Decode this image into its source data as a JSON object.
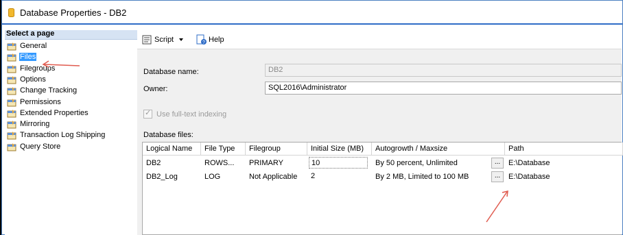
{
  "window": {
    "title": "Database Properties - DB2"
  },
  "sidebar": {
    "header": "Select a page",
    "items": [
      {
        "label": "General",
        "selected": false
      },
      {
        "label": "Files",
        "selected": true
      },
      {
        "label": "Filegroups",
        "selected": false
      },
      {
        "label": "Options",
        "selected": false
      },
      {
        "label": "Change Tracking",
        "selected": false
      },
      {
        "label": "Permissions",
        "selected": false
      },
      {
        "label": "Extended Properties",
        "selected": false
      },
      {
        "label": "Mirroring",
        "selected": false
      },
      {
        "label": "Transaction Log Shipping",
        "selected": false
      },
      {
        "label": "Query Store",
        "selected": false
      }
    ]
  },
  "toolbar": {
    "script_label": "Script",
    "help_label": "Help"
  },
  "form": {
    "database_name_label": "Database name:",
    "database_name_value": "DB2",
    "owner_label": "Owner:",
    "owner_value": "SQL2016\\Administrator",
    "fulltext_label": "Use full-text indexing",
    "fulltext_checked": true,
    "files_label": "Database files:"
  },
  "grid": {
    "columns": [
      "Logical Name",
      "File Type",
      "Filegroup",
      "Initial Size (MB)",
      "Autogrowth / Maxsize",
      "",
      "Path"
    ],
    "rows": [
      [
        "DB2",
        "ROWS...",
        "PRIMARY",
        "10",
        "By 50 percent, Unlimited",
        "...",
        "E:\\Database"
      ],
      [
        "DB2_Log",
        "LOG",
        "Not Applicable",
        "2",
        "By 2 MB, Limited to 100 MB",
        "...",
        "E:\\Database"
      ]
    ]
  },
  "colors": {
    "accent": "#2e6cc7",
    "selection": "#3399ff",
    "annotation_arrow": "#e05a4e"
  }
}
